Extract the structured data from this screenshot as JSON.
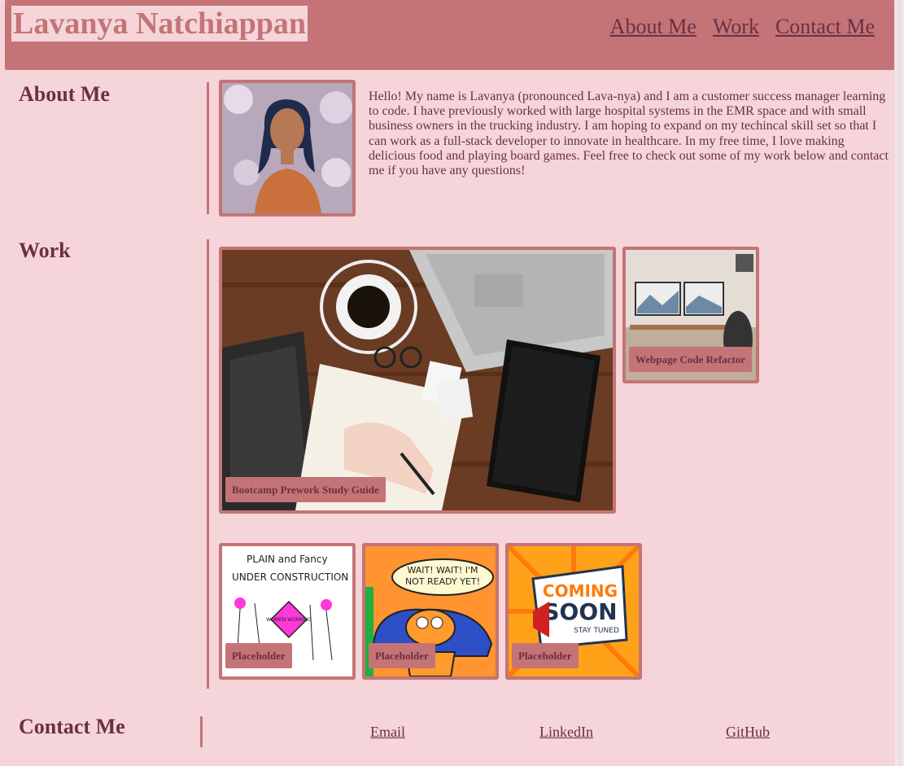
{
  "header": {
    "title": "Lavanya Natchiappan",
    "nav": [
      "About Me",
      "Work",
      "Contact Me"
    ]
  },
  "about": {
    "heading": "About Me",
    "text": "Hello! My name is Lavanya (pronounced Lava-nya) and I am a customer success manager learning to code. I have previously worked with large hospital systems in the EMR space and with small business owners in the trucking industry. I am hoping to expand on my techincal skill set so that I can work as a full-stack developer to innovate in healthcare. In my free time, I love making delicious food and playing board games. Feel free to check out some of my work below and contact me if you have any questions!"
  },
  "work": {
    "heading": "Work",
    "projects": [
      {
        "label": "Bootcamp Prework Study Guide"
      },
      {
        "label": "Webpage Code Refactor"
      },
      {
        "label": "Placeholder",
        "art_text": [
          "PLAIN and Fancy",
          "UNDER CONSTRUCTION",
          "WOMEN WORKING"
        ]
      },
      {
        "label": "Placeholder",
        "art_text": [
          "WAIT! WAIT! I'M",
          "NOT READY YET!"
        ]
      },
      {
        "label": "Placeholder",
        "art_text": [
          "COMING",
          "SOON",
          "STAY TUNED"
        ]
      }
    ]
  },
  "contact": {
    "heading": "Contact Me",
    "links": [
      "Email",
      "LinkedIn",
      "GitHub"
    ]
  },
  "colors": {
    "accent": "#c47476",
    "background": "#f5d5d9",
    "text": "#6b2f44"
  }
}
